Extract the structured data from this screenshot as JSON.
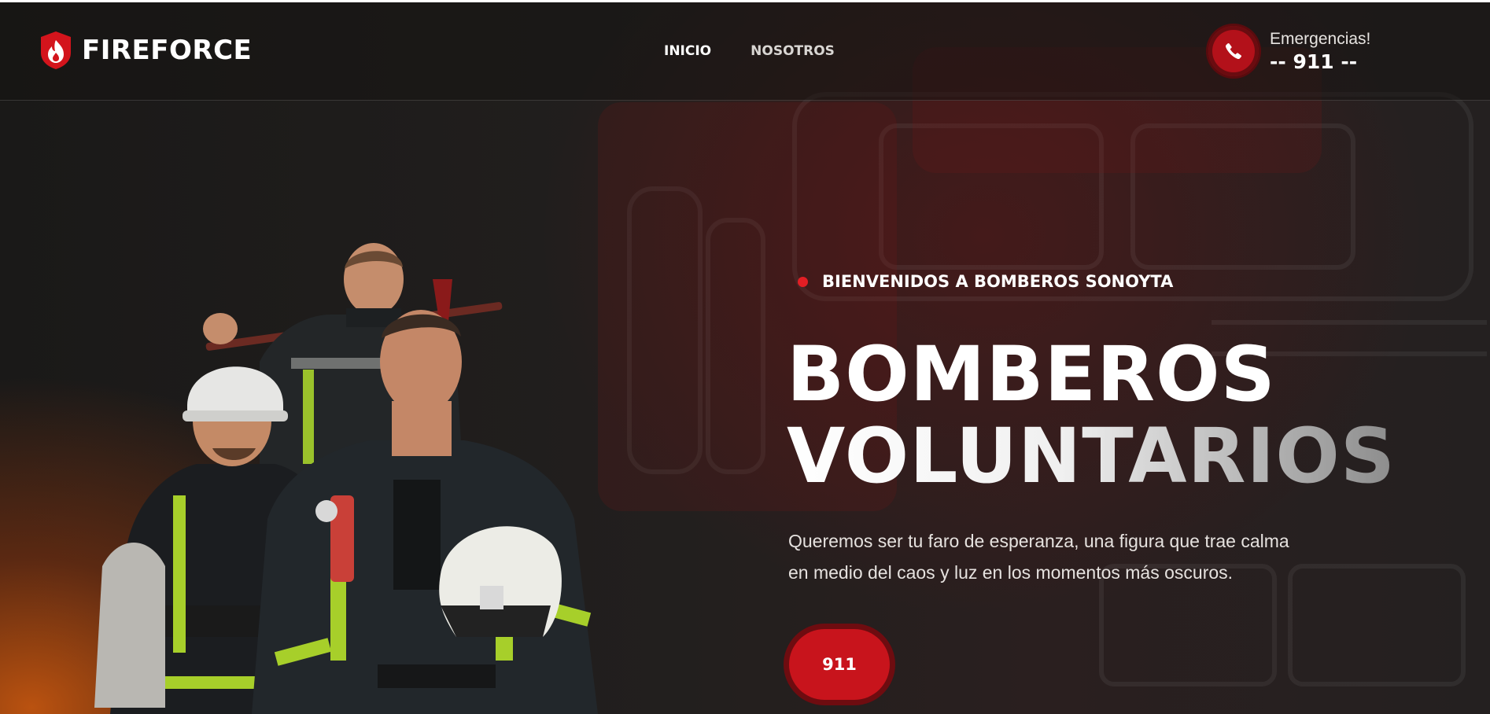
{
  "brand": {
    "name": "FIREFORCE",
    "logo_icon": "flame-shield-icon"
  },
  "nav": {
    "items": [
      {
        "label": "INICIO"
      },
      {
        "label": "NOSOTROS"
      }
    ]
  },
  "emergency": {
    "label": "Emergencias!",
    "number": "-- 911 --",
    "icon": "phone-icon"
  },
  "hero": {
    "kicker": "BIENVENIDOS A BOMBEROS SONOYTA",
    "title_line1": "BOMBEROS",
    "title_line2": "VOLUNTARIOS",
    "subtitle_line1": "Queremos ser tu faro de esperanza, una figura que trae calma",
    "subtitle_line2": "en medio del caos y luz en los momentos más oscuros.",
    "cta_label": "911",
    "image": "firefighters-photo"
  },
  "colors": {
    "accent": "#c8141c",
    "accent_dark": "#6e0c10",
    "background": "#1c1a19",
    "text": "#ffffff"
  }
}
